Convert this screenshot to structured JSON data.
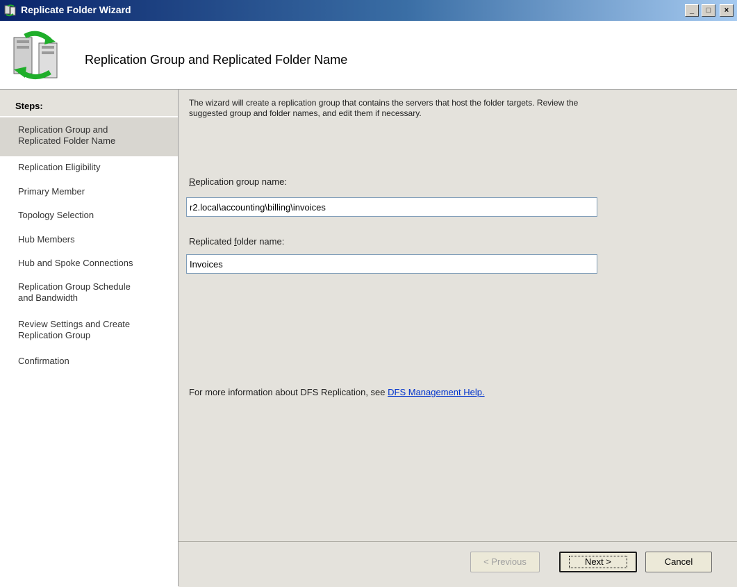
{
  "window": {
    "title": "Replicate Folder Wizard",
    "controls": {
      "minimize": "_",
      "maximize": "□",
      "close": "×"
    }
  },
  "header": {
    "title": "Replication Group and Replicated Folder Name",
    "icon": "replication-servers-icon"
  },
  "sidebar": {
    "heading": "Steps:",
    "steps": [
      {
        "label": "Replication Group and\nReplicated Folder Name",
        "active": true
      },
      {
        "label": "Replication Eligibility",
        "active": false
      },
      {
        "label": "Primary Member",
        "active": false
      },
      {
        "label": "Topology Selection",
        "active": false
      },
      {
        "label": "Hub Members",
        "active": false
      },
      {
        "label": "Hub and Spoke Connections",
        "active": false
      },
      {
        "label": "Replication Group Schedule\nand Bandwidth",
        "active": false
      },
      {
        "label": "Review Settings and Create\nReplication Group",
        "active": false
      },
      {
        "label": "Confirmation",
        "active": false
      }
    ]
  },
  "main": {
    "description": "The wizard will create a replication group that contains the servers that host the folder targets. Review the suggested group and folder names, and edit them if necessary.",
    "group_name_label_prefix": "",
    "group_name_label_accel": "R",
    "group_name_label_rest": "eplication group name:",
    "group_name_value": "r2.local\\accounting\\billing\\invoices",
    "folder_name_label_prefix": "Replicated ",
    "folder_name_label_accel": "f",
    "folder_name_label_rest": "older name:",
    "folder_name_value": "Invoices",
    "info_text": "For more information about DFS Replication, see ",
    "info_link": "DFS Management Help."
  },
  "footer": {
    "previous_label": "< Previous",
    "next_label": "Next >",
    "cancel_label": "Cancel"
  },
  "colors": {
    "titlebar_start": "#0a246a",
    "titlebar_end": "#a6caf0",
    "link": "#0033cc",
    "panel": "#e4e2dc"
  }
}
